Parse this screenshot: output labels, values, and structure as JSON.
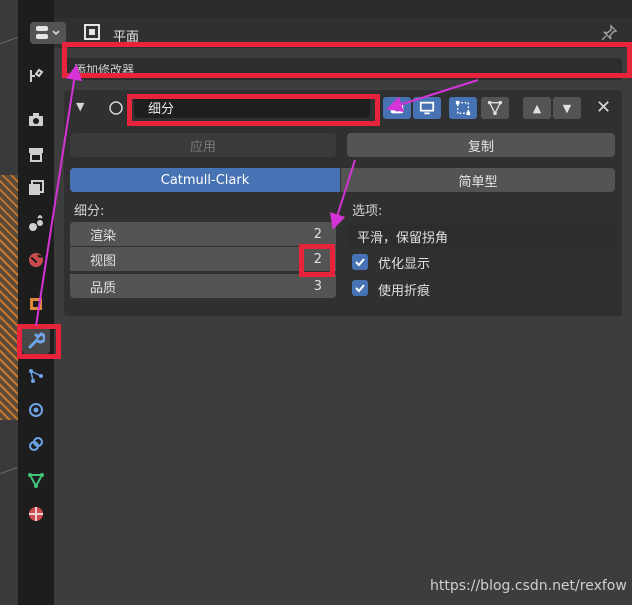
{
  "header": {
    "title": "平面"
  },
  "modifier": {
    "add_label": "添加修改器",
    "name": "细分",
    "apply_label": "应用",
    "copy_label": "复制",
    "type_tabs": [
      "Catmull-Clark",
      "简单型"
    ],
    "subdiv_heading": "细分:",
    "levels": [
      {
        "label": "渲染",
        "value": "2"
      },
      {
        "label": "视图",
        "value": "2"
      },
      {
        "label": "品质",
        "value": "3"
      }
    ],
    "options_heading": "选项:",
    "uv_smooth": "平滑，保留拐角",
    "opt_display": "优化显示",
    "use_creases": "使用折痕"
  },
  "tabs": [
    "tool-icon",
    "render-icon",
    "output-icon",
    "view-layer-icon",
    "scene-icon",
    "world-icon",
    "object-icon",
    "modifier-icon",
    "particles-icon",
    "physics-icon",
    "constraints-icon",
    "data-icon",
    "material-icon"
  ],
  "accent_color": "#4772b3",
  "annotation_color": "#e8243d",
  "arrow_color": "#d633d6",
  "watermark": "https://blog.csdn.net/rexfow"
}
